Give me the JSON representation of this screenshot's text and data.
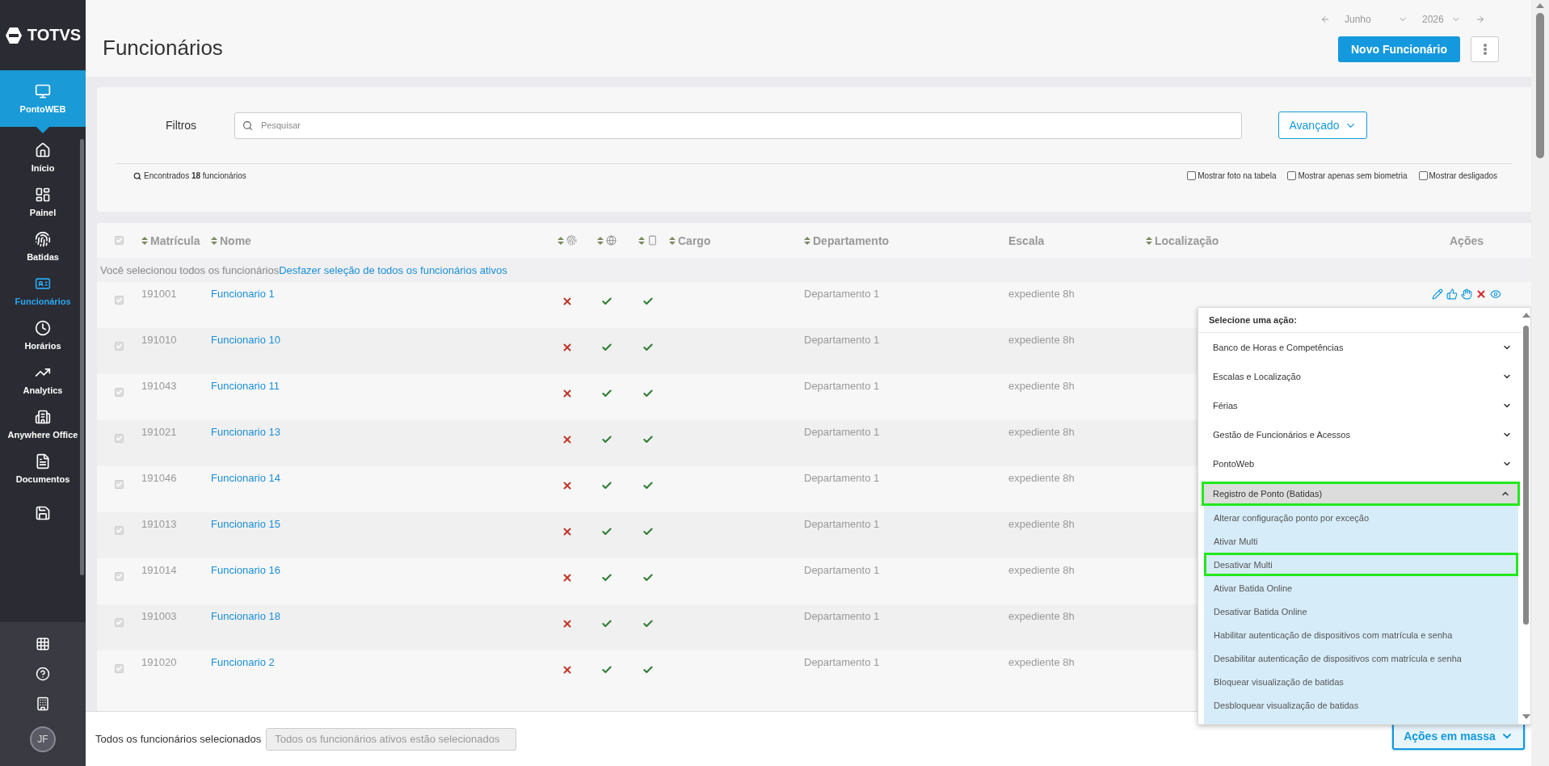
{
  "logo_text": "TOTVS",
  "sidebar": {
    "module": "PontoWEB",
    "items": [
      {
        "label": "Início",
        "selected": false
      },
      {
        "label": "Painel",
        "selected": false
      },
      {
        "label": "Batidas",
        "selected": false
      },
      {
        "label": "Funcionários",
        "selected": true
      },
      {
        "label": "Horários",
        "selected": false
      },
      {
        "label": "Analytics",
        "selected": false
      },
      {
        "label": "Anywhere Office",
        "selected": false
      },
      {
        "label": "Documentos",
        "selected": false
      }
    ],
    "avatar": "JF"
  },
  "date_nav": {
    "month": "Junho",
    "year": "2026"
  },
  "page_title": "Funcionários",
  "primary_button": "Novo Funcionário",
  "filters": {
    "label": "Filtros",
    "search_placeholder": "Pesquisar",
    "advanced_button": "Avançado",
    "found": "Encontrados **18** funcionários",
    "options": [
      {
        "label": "Mostrar foto na tabela",
        "checked": false
      },
      {
        "label": "Mostrar apenas sem biometria",
        "checked": false
      },
      {
        "label": "Mostrar desligados",
        "checked": false
      }
    ]
  },
  "table": {
    "all_checked": true,
    "columns": [
      {
        "kind": "text",
        "label": "Matrícula",
        "sortable": true
      },
      {
        "kind": "text",
        "label": "Nome",
        "sortable": true
      },
      {
        "kind": "icon",
        "sortable": true
      },
      {
        "kind": "icon",
        "sortable": true
      },
      {
        "kind": "icon",
        "sortable": true
      },
      {
        "kind": "text",
        "label": "Cargo",
        "sortable": true
      },
      {
        "kind": "text",
        "label": "Departamento",
        "sortable": true
      },
      {
        "kind": "text",
        "label": "Escala",
        "sortable": false
      },
      {
        "kind": "text",
        "label": "Localização",
        "sortable": true
      },
      {
        "kind": "text",
        "label": "Ações",
        "sortable": false
      }
    ],
    "notice": "Você selecionou todos os funcionários",
    "notice_link": "Desfazer seleção de todos os funcionários ativos",
    "rows": [
      {
        "checked": true,
        "matricula": "191001",
        "nome": "Funcionario 1",
        "biometria": false,
        "web": true,
        "mobile": true,
        "departamento": "Departamento 1",
        "escala": "expediente 8h",
        "show_actions": true
      },
      {
        "checked": true,
        "matricula": "191010",
        "nome": "Funcionario 10",
        "biometria": false,
        "web": true,
        "mobile": true,
        "departamento": "Departamento 1",
        "escala": "expediente 8h",
        "show_actions": false
      },
      {
        "checked": true,
        "matricula": "191043",
        "nome": "Funcionario 11",
        "biometria": false,
        "web": true,
        "mobile": true,
        "departamento": "Departamento 1",
        "escala": "expediente 8h",
        "show_actions": false
      },
      {
        "checked": true,
        "matricula": "191021",
        "nome": "Funcionario 13",
        "biometria": false,
        "web": true,
        "mobile": true,
        "departamento": "Departamento 1",
        "escala": "expediente 8h",
        "show_actions": false
      },
      {
        "checked": true,
        "matricula": "191046",
        "nome": "Funcionario 14",
        "biometria": false,
        "web": true,
        "mobile": true,
        "departamento": "Departamento 1",
        "escala": "expediente 8h",
        "show_actions": false
      },
      {
        "checked": true,
        "matricula": "191013",
        "nome": "Funcionario 15",
        "biometria": false,
        "web": true,
        "mobile": true,
        "departamento": "Departamento 1",
        "escala": "expediente 8h",
        "show_actions": false
      },
      {
        "checked": true,
        "matricula": "191014",
        "nome": "Funcionario 16",
        "biometria": false,
        "web": true,
        "mobile": true,
        "departamento": "Departamento 1",
        "escala": "expediente 8h",
        "show_actions": false
      },
      {
        "checked": true,
        "matricula": "191003",
        "nome": "Funcionario 18",
        "biometria": false,
        "web": true,
        "mobile": true,
        "departamento": "Departamento 1",
        "escala": "expediente 8h",
        "show_actions": false
      },
      {
        "checked": true,
        "matricula": "191020",
        "nome": "Funcionario 2",
        "biometria": false,
        "web": true,
        "mobile": true,
        "departamento": "Departamento 1",
        "escala": "expediente 8h",
        "show_actions": false
      }
    ]
  },
  "bulk": {
    "label": "Todos os funcionários selecionados",
    "value": "Todos os funcionários ativos estão selecionados",
    "button": "Ações em massa"
  },
  "action_menu": {
    "title": "Selecione uma ação:",
    "groups": [
      {
        "label": "Banco de Horas e Competências",
        "expanded": false,
        "highlighted": false
      },
      {
        "label": "Escalas e Localização",
        "expanded": false,
        "highlighted": false
      },
      {
        "label": "Férias",
        "expanded": false,
        "highlighted": false
      },
      {
        "label": "Gestão de Funcionários e Acessos",
        "expanded": false,
        "highlighted": false
      },
      {
        "label": "PontoWeb",
        "expanded": false,
        "highlighted": false
      },
      {
        "label": "Registro de Ponto (Batidas)",
        "expanded": true,
        "highlighted": true,
        "items": [
          {
            "label": "Alterar configuração ponto por exceção",
            "highlighted": false
          },
          {
            "label": "Ativar Multi",
            "highlighted": false
          },
          {
            "label": "Desativar Multi",
            "highlighted": true
          },
          {
            "label": "Ativar Batida Online",
            "highlighted": false
          },
          {
            "label": "Desativar Batida Online",
            "highlighted": false
          },
          {
            "label": "Habilitar autenticação de dispositivos com matrícula e senha",
            "highlighted": false
          },
          {
            "label": "Desabilitar autenticação de dispositivos com matrícula e senha",
            "highlighted": false
          },
          {
            "label": "Bloquear visualização de batidas",
            "highlighted": false
          },
          {
            "label": "Desbloquear visualização de batidas",
            "highlighted": false
          }
        ]
      }
    ]
  }
}
